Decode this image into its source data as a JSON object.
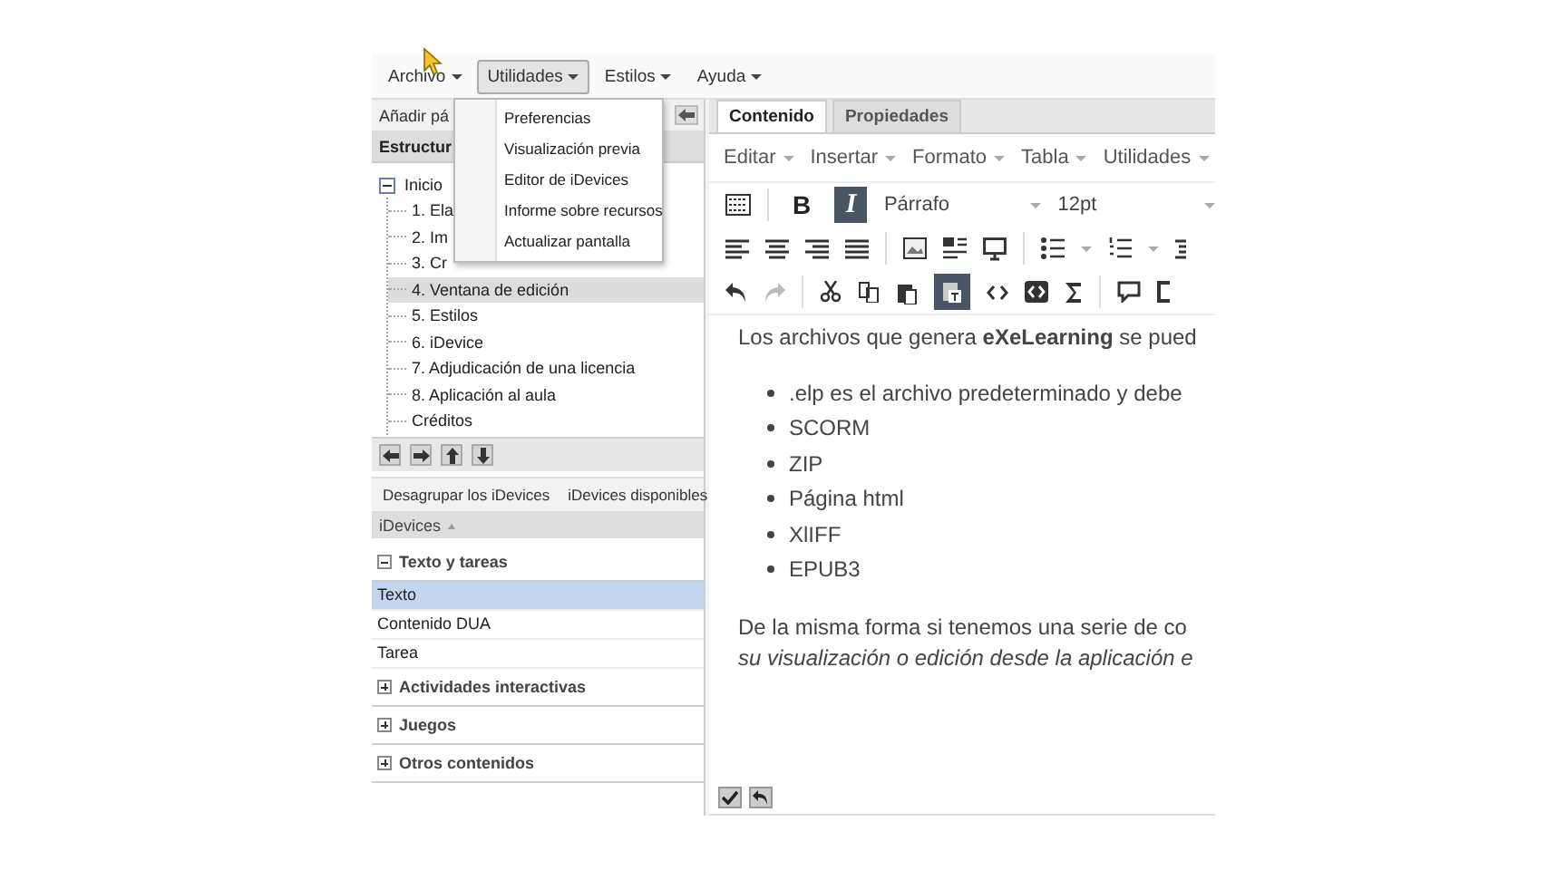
{
  "menu_bar": [
    {
      "label": "Archivo",
      "selected": false
    },
    {
      "label": "Utilidades",
      "selected": true
    },
    {
      "label": "Estilos",
      "selected": false
    },
    {
      "label": "Ayuda",
      "selected": false
    }
  ],
  "dropdown": [
    "Preferencias",
    "Visualización previa",
    "Editor de iDevices",
    "Informe sobre recursos",
    "Actualizar pantalla"
  ],
  "outline": {
    "add_page_button": "Añadir pá",
    "header": "Estructur",
    "tree": [
      {
        "label": "Inicio",
        "expanded": true,
        "selected": false,
        "children": [
          {
            "label": "1. Ela",
            "selected": false
          },
          {
            "label": "2. Im",
            "selected": false
          },
          {
            "label": "3. Cr",
            "selected": false
          },
          {
            "label": "4. Ventana de edición",
            "selected": true
          },
          {
            "label": "5. Estilos",
            "selected": false
          },
          {
            "label": "6. iDevice",
            "selected": false
          },
          {
            "label": "7. Adjudicación de una licencia",
            "selected": false
          },
          {
            "label": "8. Aplicación al aula",
            "selected": false
          },
          {
            "label": "Créditos",
            "selected": false
          }
        ]
      }
    ]
  },
  "idevices": {
    "tabs": [
      "Desagrupar los iDevices",
      "iDevices disponibles"
    ],
    "header": "iDevices",
    "groups": [
      {
        "label": "Texto y tareas",
        "expanded": true,
        "items": [
          {
            "label": "Texto",
            "selected": true
          },
          {
            "label": "Contenido DUA",
            "selected": false
          },
          {
            "label": "Tarea",
            "selected": false
          }
        ]
      },
      {
        "label": "Actividades interactivas",
        "expanded": false
      },
      {
        "label": "Juegos",
        "expanded": false
      },
      {
        "label": "Otros contenidos",
        "expanded": false
      }
    ]
  },
  "editor": {
    "tabs": [
      {
        "label": "Contenido",
        "selected": true
      },
      {
        "label": "Propiedades",
        "selected": false
      }
    ],
    "menu": [
      "Editar",
      "Insertar",
      "Formato",
      "Tabla",
      "Utilidades"
    ],
    "bold": {
      "label": "B",
      "active": false
    },
    "italic": {
      "label": "I",
      "active": true
    },
    "block_format": "Párrafo",
    "font_size": "12pt",
    "paste_as_text_active": true,
    "redo_disabled": true,
    "content": {
      "intro": "Los archivos que genera **eXeLearning** se pued",
      "list": [
        ".elp es el archivo predeterminado y debe",
        "SCORM",
        "ZIP",
        "Página html",
        "XlIFF",
        "EPUB3"
      ],
      "lines": [
        {
          "text": "De la misma forma si tenemos una serie de co",
          "italic": false
        },
        {
          "text": "su visualización o edición desde la aplicación e",
          "italic": true
        }
      ]
    }
  }
}
